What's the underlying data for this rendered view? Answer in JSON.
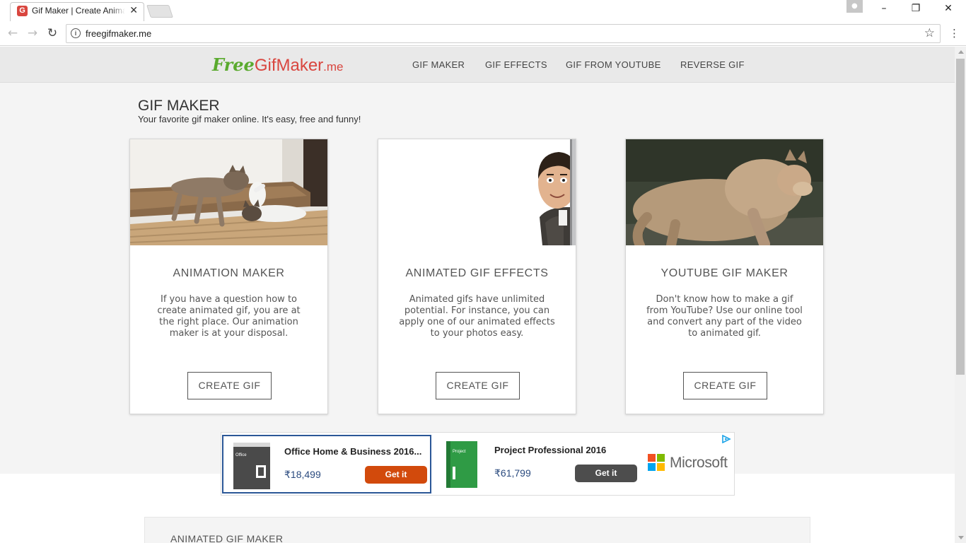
{
  "browser": {
    "tab_title": "Gif Maker | Create Animated GIF",
    "favicon_letter": "G",
    "url": "freegifmaker.me"
  },
  "site": {
    "logo": {
      "free": "Free",
      "gifmaker": "GifMaker",
      "me": ".me"
    },
    "nav": [
      "GIF MAKER",
      "GIF EFFECTS",
      "GIF FROM YOUTUBE",
      "REVERSE GIF"
    ]
  },
  "page": {
    "title": "GIF MAKER",
    "subtitle": "Your favorite gif maker online. It's easy, free and funny!"
  },
  "cards": [
    {
      "title": "ANIMATION MAKER",
      "description": "If you have a question how to create animated gif, you are at the right place. Our animation maker is at your disposal.",
      "button": "CREATE GIF"
    },
    {
      "title": "ANIMATED GIF EFFECTS",
      "description": "Animated gifs have unlimited potential. For instance, you can apply one of our animated effects to your photos easy.",
      "button": "CREATE GIF"
    },
    {
      "title": "YOUTUBE GIF MAKER",
      "description": "Don't know how to make a gif from YouTube? Use our online tool and convert any part of the video to animated gif.",
      "button": "CREATE GIF"
    }
  ],
  "ad": {
    "items": [
      {
        "name": "Office Home & Business 2016...",
        "price": "₹18,499",
        "cta": "Get it",
        "box_label": "Office"
      },
      {
        "name": "Project Professional 2016",
        "price": "₹61,799",
        "cta": "Get it",
        "box_label": "Project"
      }
    ],
    "brand": "Microsoft"
  },
  "lower": {
    "title": "ANIMATED GIF MAKER"
  },
  "colors": {
    "brand_red": "#d9463f",
    "brand_green": "#5aaa2e",
    "cta_orange": "#d24a0c",
    "cta_gray": "#4d4d4d"
  }
}
